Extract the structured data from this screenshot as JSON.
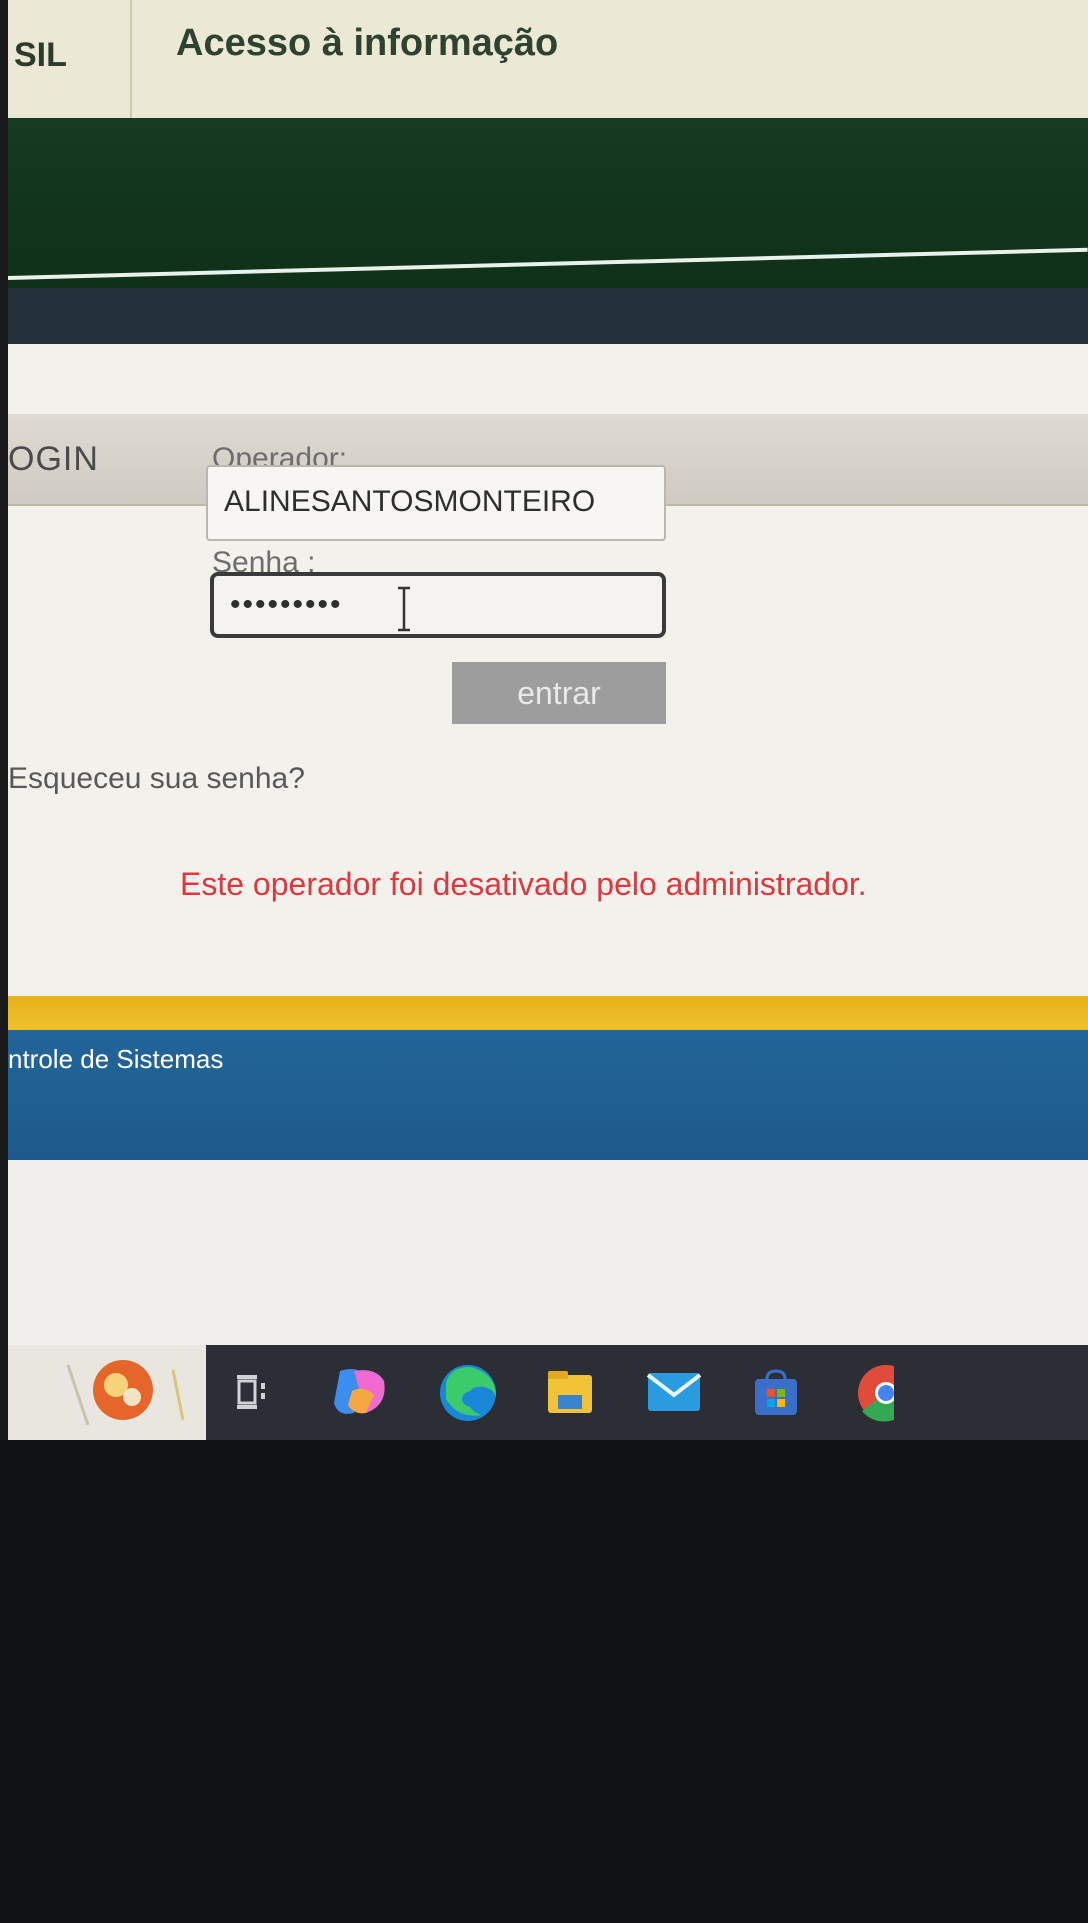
{
  "gov_bar": {
    "left_text": "SIL",
    "access_link": "Acesso à informação"
  },
  "login": {
    "title": "OGIN",
    "operator_label": "Operador:",
    "operator_value": "ALINESANTOSMONTEIRO",
    "password_label": "Senha :",
    "password_mask": "•••••••••",
    "submit_label": "entrar",
    "forgot_link": "Esqueceu sua senha?",
    "error_message": "Este operador foi desativado pelo administrador."
  },
  "footer": {
    "system_text": "ntrole de Sistemas"
  },
  "taskbar": {
    "icons": [
      "weather-widget-icon",
      "task-view-icon",
      "copilot-icon",
      "edge-icon",
      "file-explorer-icon",
      "mail-icon",
      "store-icon",
      "chrome-icon"
    ]
  },
  "colors": {
    "error": "#e0373e",
    "header_green": "#163a22",
    "footer_blue": "#236599",
    "footer_yellow": "#e7b21b",
    "button_gray": "#9d9d9d"
  }
}
